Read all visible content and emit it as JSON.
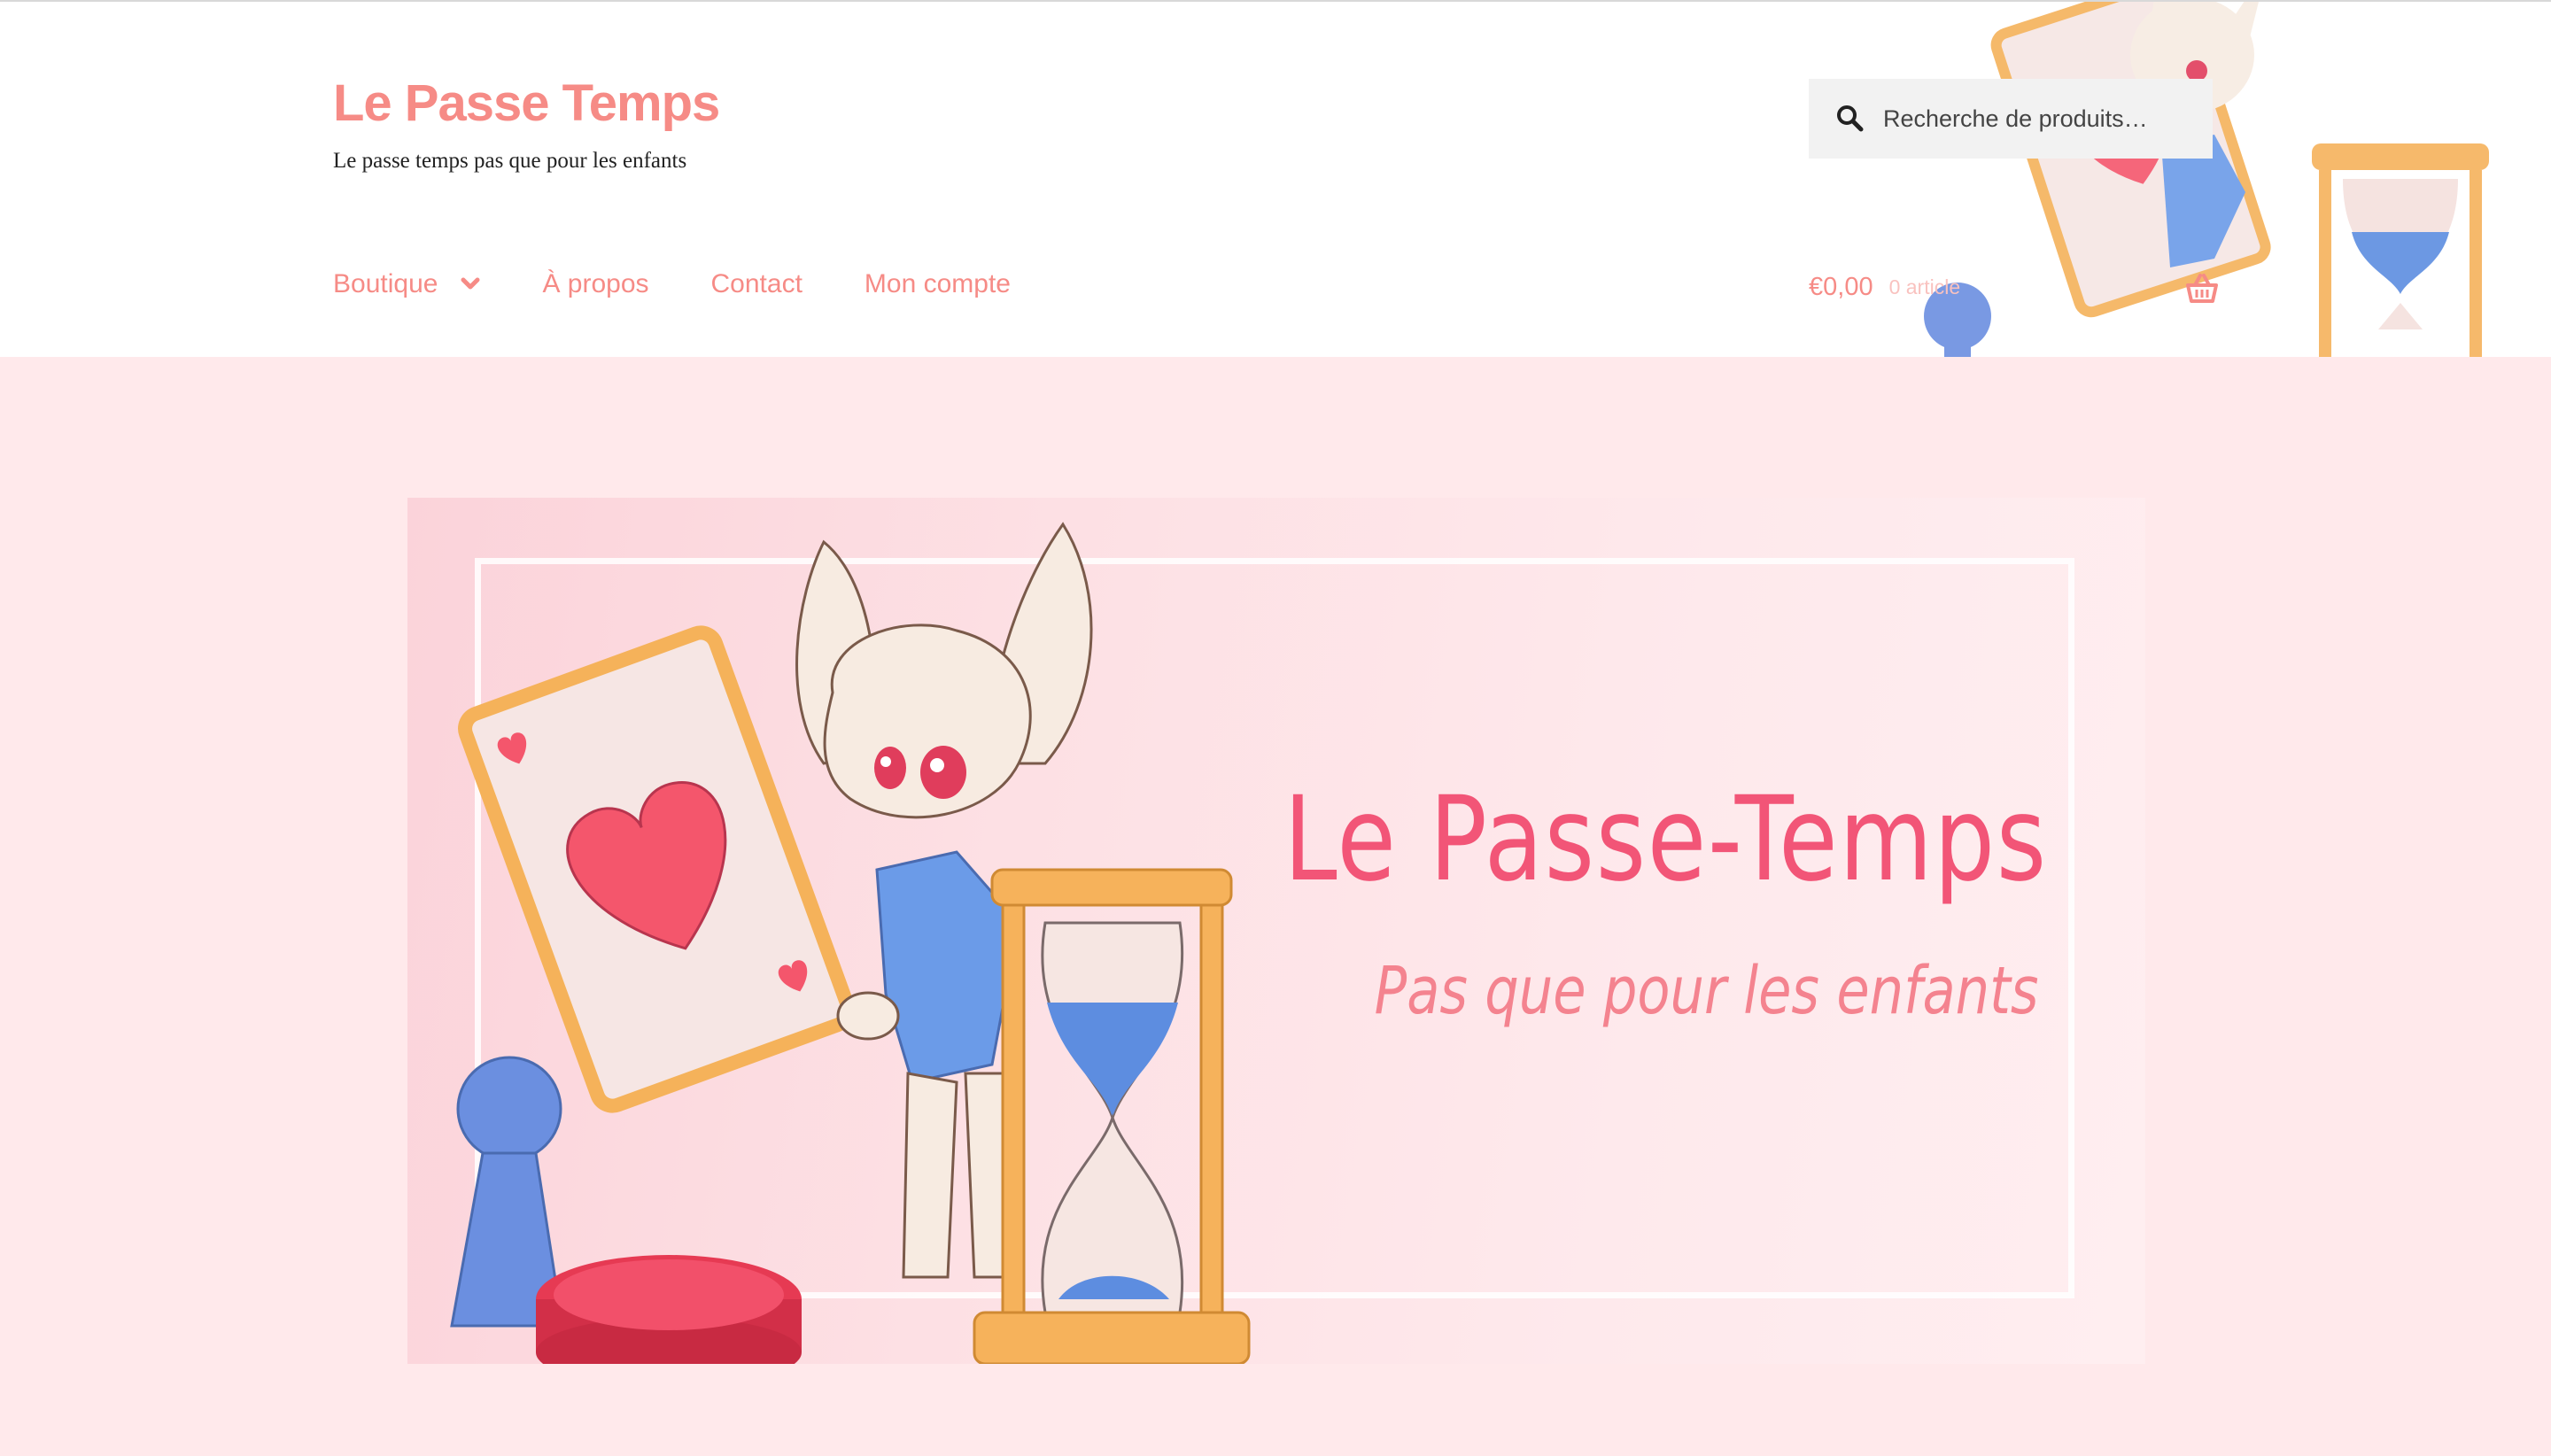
{
  "site": {
    "title": "Le Passe Temps",
    "tagline": "Le passe temps pas que pour les enfants"
  },
  "search": {
    "placeholder": "Recherche de produits…",
    "icon": "search-icon"
  },
  "nav": {
    "items": [
      {
        "label": "Boutique",
        "has_dropdown": true
      },
      {
        "label": "À propos"
      },
      {
        "label": "Contact"
      },
      {
        "label": "Mon compte"
      }
    ]
  },
  "cart": {
    "total": "€0,00",
    "count": "0 article",
    "icon": "basket-icon"
  },
  "hero": {
    "title": "Le Passe-Temps",
    "subtitle": "Pas que pour les enfants"
  },
  "colors": {
    "brand": "#f68b86",
    "hero_title": "#f25577",
    "hero_subtitle": "#f4838f",
    "page_background": "#ffe9eb",
    "search_background": "#f2f2f2"
  }
}
